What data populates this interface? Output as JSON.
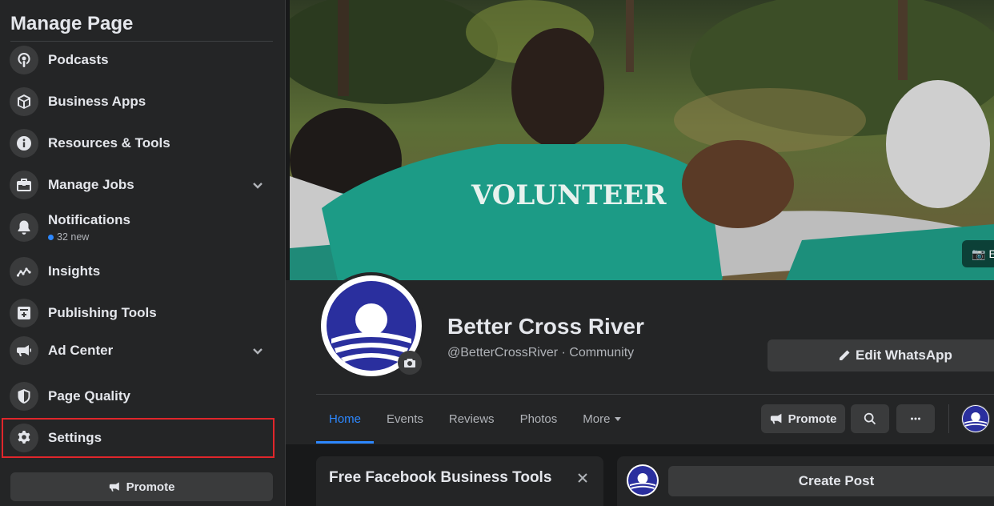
{
  "sidebar": {
    "title": "Manage Page",
    "items": [
      {
        "label": "Podcasts",
        "icon": "podcast-icon"
      },
      {
        "label": "Business Apps",
        "icon": "box-icon"
      },
      {
        "label": "Resources & Tools",
        "icon": "info-icon"
      },
      {
        "label": "Manage Jobs",
        "icon": "briefcase-icon",
        "expandable": true
      },
      {
        "label": "Notifications",
        "icon": "bell-icon",
        "subtext": "32 new"
      },
      {
        "label": "Insights",
        "icon": "insights-icon"
      },
      {
        "label": "Publishing Tools",
        "icon": "publishing-icon"
      },
      {
        "label": "Ad Center",
        "icon": "megaphone-icon",
        "expandable": true
      },
      {
        "label": "Page Quality",
        "icon": "shield-icon"
      },
      {
        "label": "Settings",
        "icon": "gear-icon",
        "selected": true
      }
    ],
    "promote_label": "Promote"
  },
  "cover": {
    "shirt_text": "VOLUNTEER",
    "edit_label": "E"
  },
  "page": {
    "name": "Better Cross River",
    "handle": "@BetterCrossRiver · Community",
    "edit_whatsapp_label": "Edit WhatsApp"
  },
  "tabs": [
    {
      "label": "Home",
      "active": true
    },
    {
      "label": "Events"
    },
    {
      "label": "Reviews"
    },
    {
      "label": "Photos"
    },
    {
      "label": "More",
      "dropdown": true
    }
  ],
  "actions": {
    "promote_label": "Promote"
  },
  "cards": {
    "tools_title": "Free Facebook Business Tools",
    "create_post_label": "Create Post"
  },
  "colors": {
    "accent": "#2d88ff",
    "highlight": "#e0262b",
    "logo_blue": "#2a2f9e"
  }
}
